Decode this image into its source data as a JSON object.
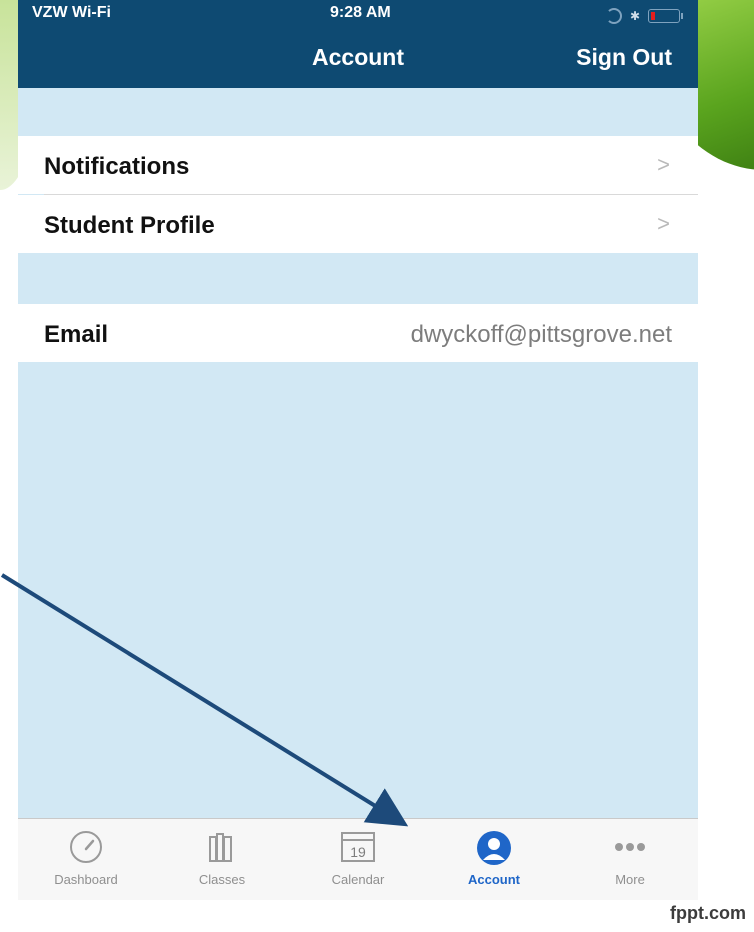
{
  "status_bar": {
    "carrier": "VZW Wi-Fi",
    "time": "9:28 AM"
  },
  "nav": {
    "title": "Account",
    "sign_out": "Sign Out"
  },
  "rows": {
    "notifications": "Notifications",
    "student_profile": "Student Profile",
    "email_label": "Email",
    "email_value": "dwyckoff@pittsgrove.net"
  },
  "tabs": [
    {
      "label": "Dashboard",
      "icon": "gauge-icon"
    },
    {
      "label": "Classes",
      "icon": "books-icon"
    },
    {
      "label": "Calendar",
      "icon": "calendar-icon",
      "day": "19"
    },
    {
      "label": "Account",
      "icon": "person-icon",
      "active": true
    },
    {
      "label": "More",
      "icon": "more-dots-icon"
    }
  ],
  "colors": {
    "nav": "#0e4a72",
    "background": "#d2e8f4",
    "active_tab": "#1f66c8",
    "arrow": "#1d4a7a"
  },
  "watermark": "fppt.com"
}
